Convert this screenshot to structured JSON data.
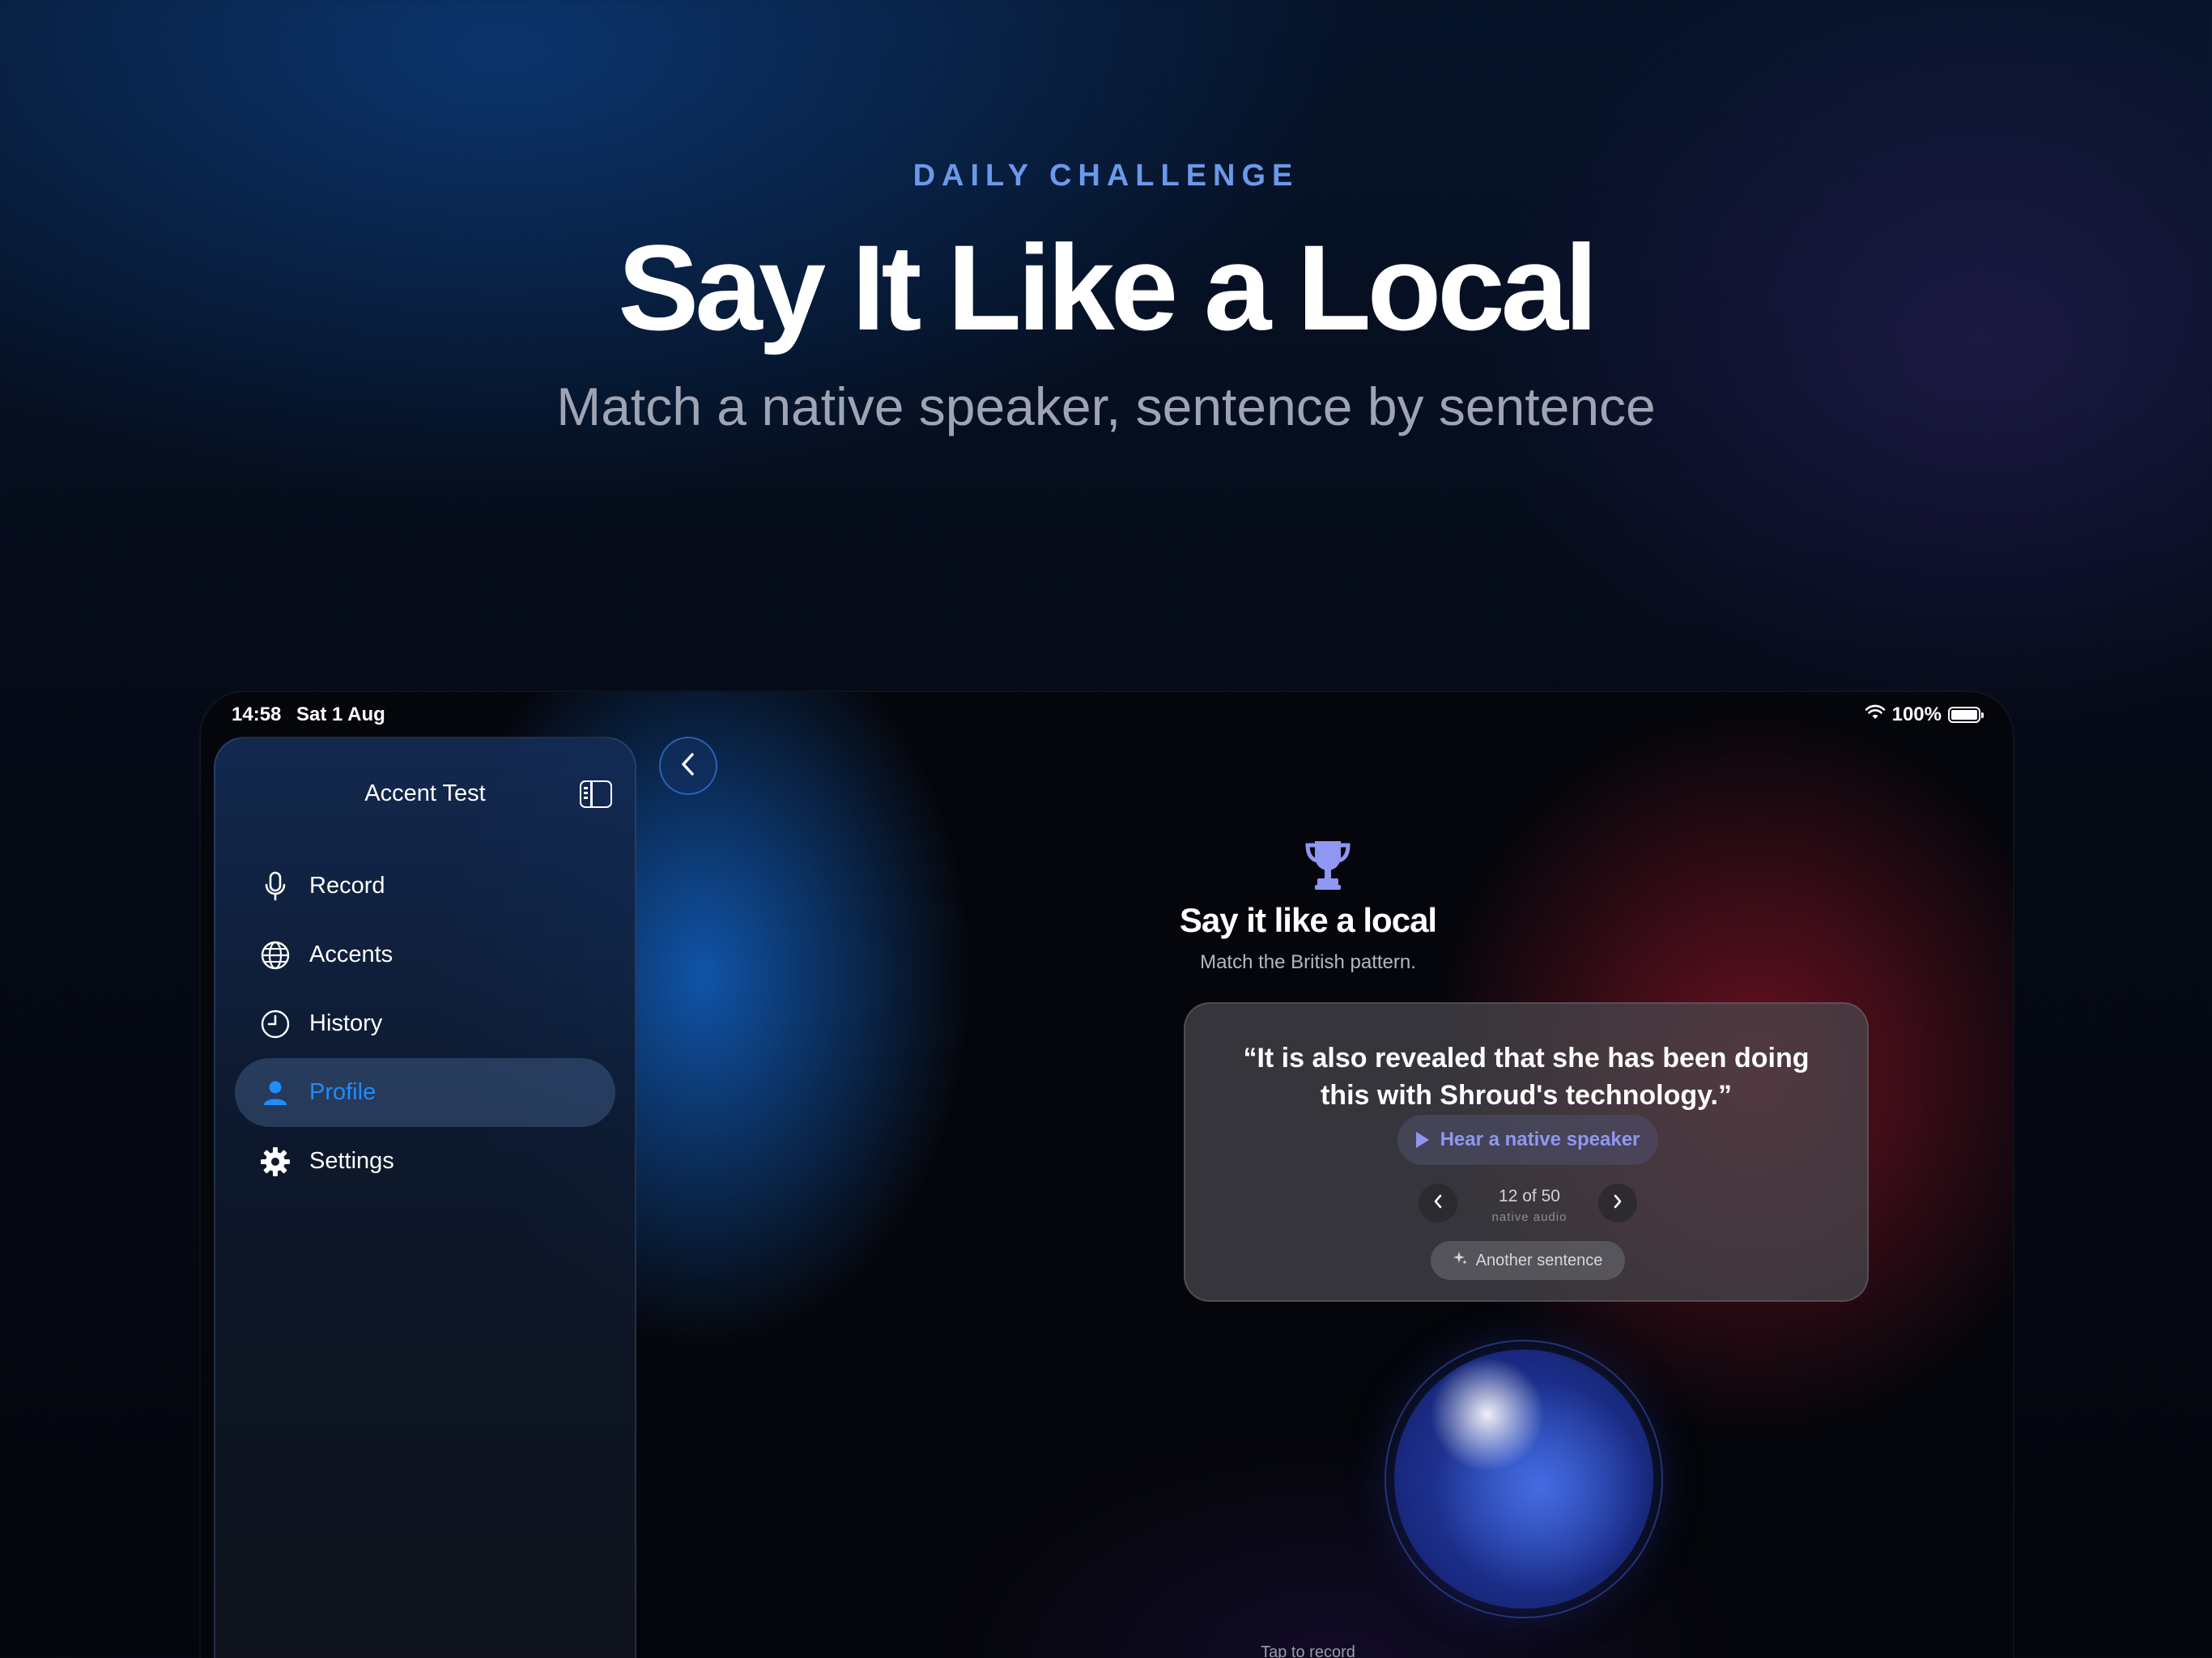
{
  "hero": {
    "eyebrow": "DAILY CHALLENGE",
    "headline": "Say It Like a Local",
    "subhead": "Match a native speaker, sentence by sentence"
  },
  "status_bar": {
    "time": "14:58",
    "date": "Sat 1 Aug",
    "battery": "100%",
    "battery_level": 1.0
  },
  "sidebar": {
    "title": "Accent Test",
    "items": [
      {
        "label": "Record",
        "icon": "mic-icon",
        "active": false
      },
      {
        "label": "Accents",
        "icon": "globe-icon",
        "active": false
      },
      {
        "label": "History",
        "icon": "clock-icon",
        "active": false
      },
      {
        "label": "Profile",
        "icon": "person-icon",
        "active": true
      },
      {
        "label": "Settings",
        "icon": "gear-icon",
        "active": false
      }
    ]
  },
  "challenge": {
    "title": "Say it like a local",
    "subtitle": "Match the British pattern.",
    "quote": "“It is also revealed that she has been doing this with Shroud's technology.”",
    "hear_button": "Hear a native speaker",
    "pager_count": "12 of 50",
    "pager_caption": "native audio",
    "another_button": "Another sentence",
    "record_hint": "Tap to record"
  },
  "colors": {
    "accent": "#1f8cff",
    "eyebrow": "#6b99ea",
    "hear_text": "#8f97f2"
  }
}
